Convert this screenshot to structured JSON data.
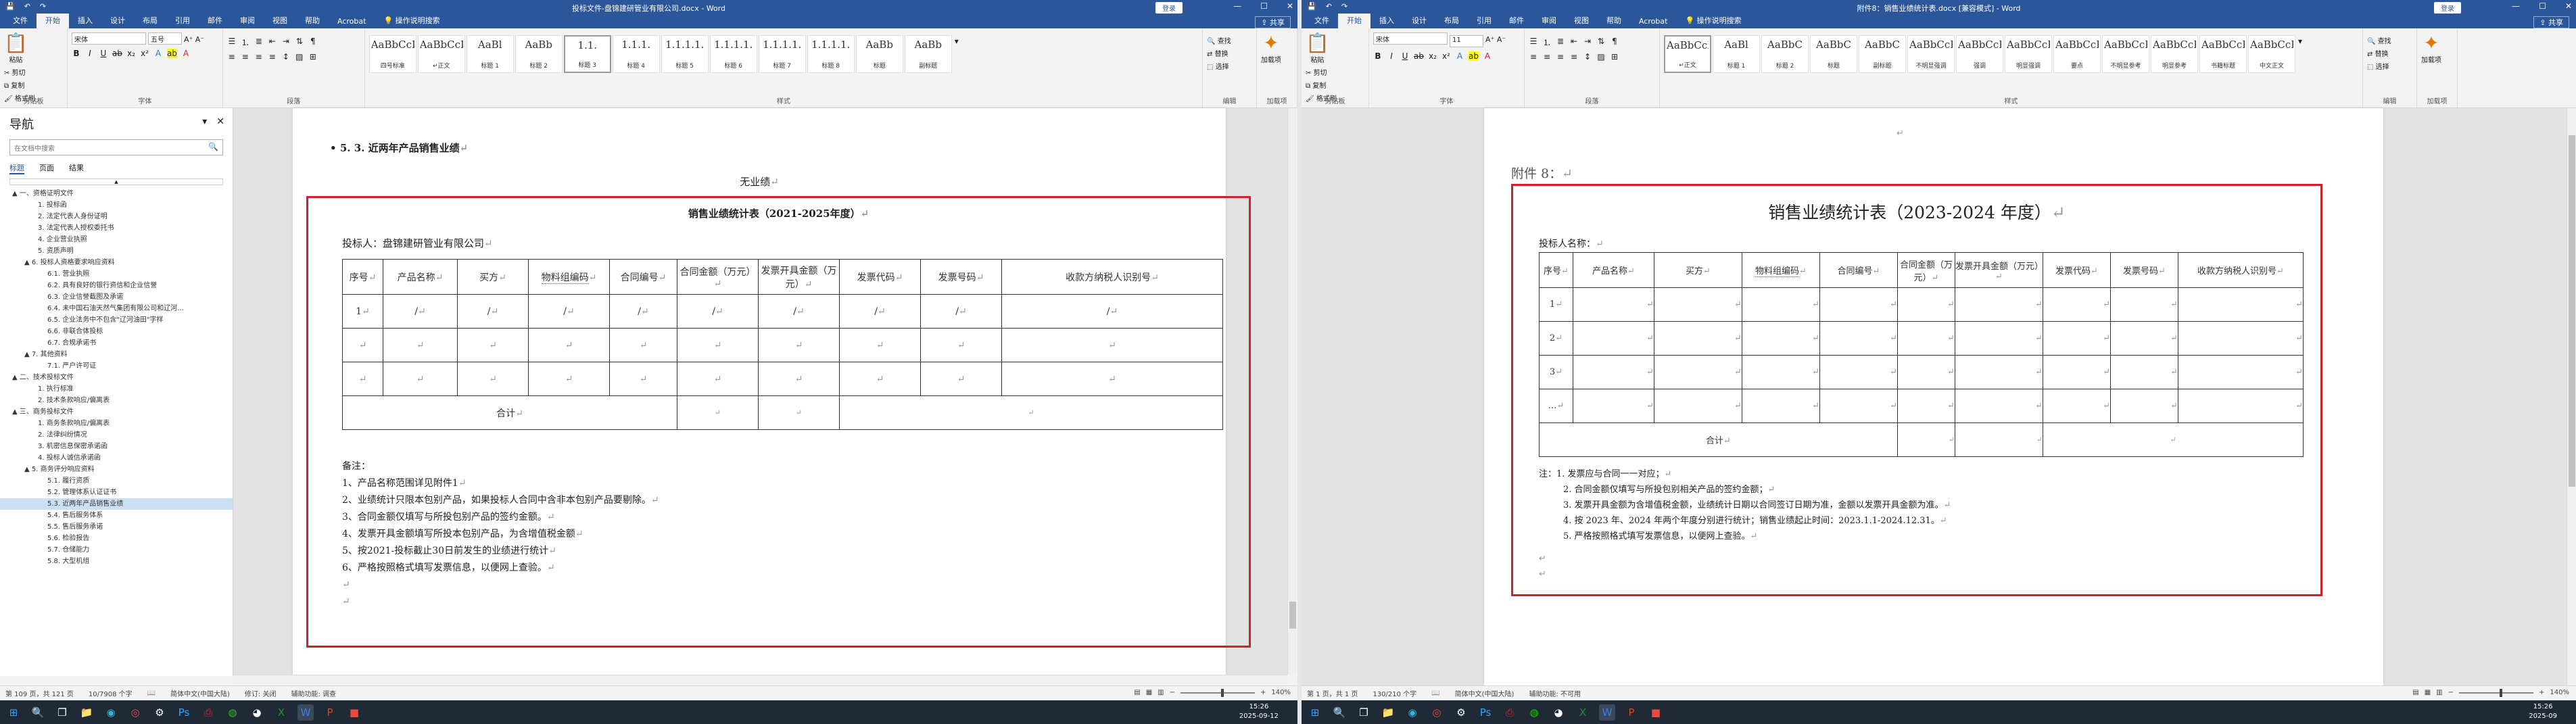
{
  "left_window": {
    "title": "投标文件-盘锦建研管业有限公司.docx - Word",
    "login": "登录",
    "share": "共享",
    "qa_icons": [
      "save-icon",
      "undo-icon",
      "redo-icon"
    ],
    "menu_tabs": [
      "文件",
      "开始",
      "插入",
      "设计",
      "布局",
      "引用",
      "邮件",
      "审阅",
      "视图",
      "帮助",
      "Acrobat",
      "操作说明搜索"
    ],
    "ribbon": {
      "clipboard": {
        "paste": "粘贴",
        "cut": "剪切",
        "copy": "复制",
        "format_painter": "格式刷",
        "group": "剪贴板"
      },
      "font": {
        "font_name": "宋体",
        "font_size": "五号",
        "group": "字体"
      },
      "paragraph": {
        "group": "段落"
      },
      "styles": {
        "items": [
          {
            "preview": "AaBbCcDc",
            "name": "四号标准"
          },
          {
            "preview": "AaBbCcDc",
            "name": "↵正文"
          },
          {
            "preview": "AaBl",
            "name": "标题 1"
          },
          {
            "preview": "AaBb",
            "name": "标题 2"
          },
          {
            "preview": "1.1.",
            "name": "标题 3"
          },
          {
            "preview": "1.1.1.",
            "name": "标题 4"
          },
          {
            "preview": "1.1.1.1.",
            "name": "标题 5"
          },
          {
            "preview": "1.1.1.1.",
            "name": "标题 6"
          },
          {
            "preview": "1.1.1.1.",
            "name": "标题 7"
          },
          {
            "preview": "1.1.1.1.",
            "name": "标题 8"
          },
          {
            "preview": "AaBb",
            "name": "标题"
          },
          {
            "preview": "AaBb",
            "name": "副标题"
          }
        ],
        "group": "样式"
      },
      "editing": {
        "find": "查找",
        "replace": "替换",
        "select": "选择",
        "group": "编辑"
      },
      "addins": {
        "label": "加载项",
        "group": "加载项"
      }
    },
    "nav": {
      "title": "导航",
      "search_placeholder": "在文档中搜索",
      "tabs": [
        "标题",
        "页面",
        "结果"
      ],
      "items": [
        "▲ 一、资格证明文件",
        "1. 投标函",
        "2. 法定代表人身份证明",
        "3. 法定代表人授权委托书",
        "4. 企业营业执照",
        "5. 资质声明",
        "▲ 6. 投标人资格要求响应资料",
        "6.1. 营业执照",
        "6.2. 具有良好的银行资信和企业信誉",
        "6.3. 企业信誉截图及承诺",
        "6.4. 未中国石油天然气集团有限公司和辽河...",
        "6.5. 企业法务中不包含\"辽河油田\"字样",
        "6.6. 非联合体投标",
        "6.7. 合规承诺书",
        "▲ 7. 其他资料",
        "7.1. 严户许可证",
        "▲ 二、技术投标文件",
        "1. 执行标准",
        "2. 技术条款响应/偏离表",
        "▲ 三、商务投标文件",
        "1. 商务条款响应/偏离表",
        "2. 法律纠纷情况",
        "3. 机密信息保密承诺函",
        "4. 投标人诚信承诺函",
        "▲ 5. 商务评分响应资料",
        "5.1. 履行资质",
        "5.2. 管理体系认证证书",
        "5.3. 近两年产品销售业绩",
        "5.4. 售后服务体系",
        "5.5. 售后服务承诺",
        "5.6. 检验报告",
        "5.7. 仓储能力",
        "5.8. 大型机组"
      ],
      "current_index": 27
    },
    "doc": {
      "heading": "5. 3. 近两年产品销售业绩",
      "no_record": "无业绩",
      "table_title": "销售业绩统计表（2021-2025年度）",
      "bidder_label": "投标人：",
      "bidder_name": "盘锦建研管业有限公司",
      "headers": [
        "序号",
        "产品名称",
        "买方",
        "物料组编码",
        "合同编号",
        "合同金额（万元）",
        "发票开具金额（万元）",
        "发票代码",
        "发票号码",
        "收款方纳税人识别号"
      ],
      "rows": [
        [
          "1",
          "/",
          "/",
          "/",
          "/",
          "/",
          "/",
          "/",
          "/",
          "/"
        ],
        [
          "",
          "",
          "",
          "",
          "",
          "",
          "",
          "",
          "",
          ""
        ],
        [
          "",
          "",
          "",
          "",
          "",
          "",
          "",
          "",
          "",
          ""
        ]
      ],
      "total_label": "合计",
      "notes_title": "备注：",
      "notes": [
        "1、产品名称范围详见附件1",
        "2、业绩统计只限本包别产品，如果投标人合同中含非本包别产品要剔除。",
        "3、合同金额仅填写与所投包别产品的签约金额。",
        "4、发票开具金额填写所投本包别产品，为含增值税金额",
        "5、按2021-投标截止30日前发生的业绩进行统计",
        "6、严格按照格式填写发票信息，以便网上查验。"
      ]
    },
    "status": {
      "page": "第 109 页，共 121 页",
      "words": "10/7908 个字",
      "lang": "简体中文(中国大陆)",
      "track": "修订: 关闭",
      "access": "辅助功能: 调查",
      "zoom": "140%"
    }
  },
  "right_window": {
    "title": "附件8：销售业绩统计表.docx [兼容模式] - Word",
    "login": "登录",
    "share": "共享",
    "menu_tabs": [
      "文件",
      "开始",
      "插入",
      "设计",
      "布局",
      "引用",
      "邮件",
      "审阅",
      "视图",
      "帮助",
      "Acrobat",
      "操作说明搜索"
    ],
    "ribbon": {
      "clipboard": {
        "paste": "粘贴",
        "cut": "剪切",
        "copy": "复制",
        "format_painter": "格式刷",
        "group": "剪贴板"
      },
      "font": {
        "font_name": "宋体",
        "font_size": "11",
        "group": "字体"
      },
      "paragraph": {
        "group": "段落"
      },
      "styles": {
        "items": [
          {
            "preview": "AaBbCcDc",
            "name": "↵正文"
          },
          {
            "preview": "AaBl",
            "name": "标题 1"
          },
          {
            "preview": "AaBbC",
            "name": "标题 2"
          },
          {
            "preview": "AaBbC",
            "name": "标题"
          },
          {
            "preview": "AaBbC",
            "name": "副标题"
          },
          {
            "preview": "AaBbCcDdt",
            "name": "不明显强调"
          },
          {
            "preview": "AaBbCcDdt",
            "name": "强调"
          },
          {
            "preview": "AaBbCcDdt",
            "name": "明显强调"
          },
          {
            "preview": "AaBbCcDdt",
            "name": "要点"
          },
          {
            "preview": "AaBbCcDdE",
            "name": "不明显参考"
          },
          {
            "preview": "AaBbCcDdt",
            "name": "明显参考"
          },
          {
            "preview": "AaBbCcDdt",
            "name": "书籍标题"
          },
          {
            "preview": "AaBbCcDd",
            "name": "中文正文"
          }
        ],
        "group": "样式"
      },
      "editing": {
        "find": "查找",
        "replace": "替换",
        "select": "选择",
        "group": "编辑"
      },
      "addins": {
        "label": "加载项",
        "group": "加载项"
      }
    },
    "doc": {
      "attachment": "附件 8：",
      "table_title": "销售业绩统计表（2023-2024 年度）",
      "bidder_label": "投标人名称：",
      "headers": [
        "序号",
        "产品名称",
        "买方",
        "物料组编码",
        "合同编号",
        "合同金额（万元）",
        "发票开具金额（万元）",
        "发票代码",
        "发票号码",
        "收款方纳税人识别号"
      ],
      "row_numbers": [
        "1",
        "2",
        "3",
        "…"
      ],
      "total_label": "合计",
      "notes": [
        "注：1. 发票应与合同一一对应；",
        "2. 合同金额仅填写与所投包别相关产品的签约金额；",
        "3. 发票开具金额为含增值税金额，业绩统计日期以合同签订日期为准，金额以发票开具金额为准。",
        "4. 按 2023 年、2024 年两个年度分别进行统计；销售业绩起止时间：2023.1.1-2024.12.31。",
        "5. 严格按照格式填写发票信息，以便网上查验。"
      ]
    },
    "status": {
      "page": "第 1 页，共 1 页",
      "words": "130/210 个字",
      "lang": "简体中文(中国大陆)",
      "access": "辅助功能: 不可用",
      "zoom": "140%"
    }
  },
  "taskbar_left": {
    "time": "15:26",
    "date": "2025-09-12"
  },
  "taskbar_right": {
    "time": "15:26",
    "date": "2025-09"
  },
  "colors": {
    "word_blue": "#2b579a",
    "highlight_frame": "#d0202a",
    "taskbar": "#1f2a36"
  }
}
